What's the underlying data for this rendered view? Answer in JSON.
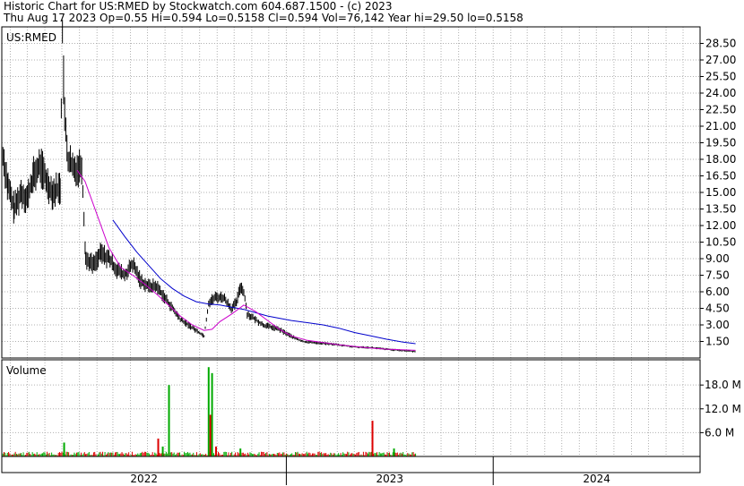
{
  "header": {
    "line1": "Historic Chart for US:RMED by Stockwatch.com 604.687.1500 - (c) 2023",
    "line2": "Thu Aug 17 2023  Op=0.55  Hi=0.594  Lo=0.5158  Cl=0.594  Vol=76,142  Year hi=29.50  lo=0.5158"
  },
  "colors": {
    "price_bars": "#000000",
    "ma_short": "#cc00cc",
    "ma_long": "#0000cc",
    "volume_up": "#00aa00",
    "volume_down": "#dd0000",
    "grid": "#b0b0b0"
  },
  "chart_data": [
    {
      "type": "line",
      "title": "US:RMED",
      "y_ticks": [
        "1.50",
        "3.00",
        "4.50",
        "6.00",
        "7.50",
        "9.00",
        "10.50",
        "12.00",
        "13.50",
        "15.00",
        "16.50",
        "18.00",
        "19.50",
        "21.00",
        "22.50",
        "24.00",
        "25.50",
        "27.00",
        "28.50"
      ],
      "y_tick_values": [
        1.5,
        3,
        4.5,
        6,
        7.5,
        9,
        10.5,
        12,
        13.5,
        15,
        16.5,
        18,
        19.5,
        21,
        22.5,
        24,
        25.5,
        27,
        28.5
      ],
      "ylim": [
        0,
        30
      ],
      "x_range": [
        "2021-08-17",
        "2024-12-31"
      ],
      "x_labels": [
        "2022",
        "2023",
        "2024"
      ],
      "grid": true,
      "price_points": [
        [
          "2021-08-17",
          19.0
        ],
        [
          "2021-08-28",
          15.5
        ],
        [
          "2021-09-08",
          13.5
        ],
        [
          "2021-09-20",
          15.0
        ],
        [
          "2021-10-01",
          14.5
        ],
        [
          "2021-10-12",
          16.5
        ],
        [
          "2021-10-24",
          17.5
        ],
        [
          "2021-11-04",
          16.0
        ],
        [
          "2021-11-15",
          15.0
        ],
        [
          "2021-11-28",
          15.5
        ],
        [
          "2021-12-02",
          29.5
        ],
        [
          "2021-12-06",
          21.5
        ],
        [
          "2021-12-12",
          18.0
        ],
        [
          "2021-12-22",
          17.0
        ],
        [
          "2022-01-05",
          17.5
        ],
        [
          "2022-01-12",
          9.0
        ],
        [
          "2022-01-26",
          8.5
        ],
        [
          "2022-02-08",
          9.5
        ],
        [
          "2022-02-22",
          9.0
        ],
        [
          "2022-03-08",
          8.0
        ],
        [
          "2022-03-22",
          7.5
        ],
        [
          "2022-04-05",
          8.5
        ],
        [
          "2022-04-19",
          7.0
        ],
        [
          "2022-05-03",
          6.5
        ],
        [
          "2022-05-17",
          6.5
        ],
        [
          "2022-05-31",
          5.5
        ],
        [
          "2022-06-14",
          4.5
        ],
        [
          "2022-06-28",
          3.5
        ],
        [
          "2022-07-12",
          3.0
        ],
        [
          "2022-07-26",
          2.5
        ],
        [
          "2022-08-09",
          2.0
        ],
        [
          "2022-08-17",
          5.0
        ],
        [
          "2022-08-29",
          5.5
        ],
        [
          "2022-09-12",
          5.5
        ],
        [
          "2022-09-26",
          4.5
        ],
        [
          "2022-10-05",
          5.0
        ],
        [
          "2022-10-12",
          6.5
        ],
        [
          "2022-10-18",
          6.0
        ],
        [
          "2022-10-24",
          4.0
        ],
        [
          "2022-11-07",
          3.5
        ],
        [
          "2022-11-21",
          3.0
        ],
        [
          "2022-12-05",
          2.8
        ],
        [
          "2022-12-19",
          2.6
        ],
        [
          "2023-01-02",
          2.2
        ],
        [
          "2023-01-16",
          1.8
        ],
        [
          "2023-01-30",
          1.5
        ],
        [
          "2023-02-20",
          1.4
        ],
        [
          "2023-03-13",
          1.3
        ],
        [
          "2023-04-03",
          1.2
        ],
        [
          "2023-05-01",
          1.0
        ],
        [
          "2023-05-29",
          0.95
        ],
        [
          "2023-06-26",
          0.8
        ],
        [
          "2023-07-17",
          0.7
        ],
        [
          "2023-08-17",
          0.594
        ]
      ],
      "ma_short": [
        [
          "2021-12-28",
          17.0
        ],
        [
          "2022-01-11",
          16.0
        ],
        [
          "2022-02-01",
          13.0
        ],
        [
          "2022-02-22",
          10.0
        ],
        [
          "2022-03-15",
          8.2
        ],
        [
          "2022-04-05",
          7.5
        ],
        [
          "2022-04-26",
          6.7
        ],
        [
          "2022-05-17",
          5.8
        ],
        [
          "2022-06-07",
          4.8
        ],
        [
          "2022-06-28",
          3.8
        ],
        [
          "2022-07-19",
          3.0
        ],
        [
          "2022-08-09",
          2.5
        ],
        [
          "2022-08-23",
          2.6
        ],
        [
          "2022-09-06",
          3.3
        ],
        [
          "2022-09-27",
          4.0
        ],
        [
          "2022-10-18",
          4.8
        ],
        [
          "2022-11-08",
          4.2
        ],
        [
          "2022-11-29",
          3.4
        ],
        [
          "2022-12-20",
          2.6
        ],
        [
          "2023-01-10",
          2.0
        ],
        [
          "2023-02-07",
          1.6
        ],
        [
          "2023-03-07",
          1.4
        ],
        [
          "2023-04-04",
          1.2
        ],
        [
          "2023-05-02",
          1.05
        ],
        [
          "2023-05-30",
          0.9
        ],
        [
          "2023-06-27",
          0.8
        ],
        [
          "2023-08-17",
          0.7
        ]
      ],
      "ma_long": [
        [
          "2022-03-01",
          12.5
        ],
        [
          "2022-03-22",
          11.0
        ],
        [
          "2022-04-12",
          9.6
        ],
        [
          "2022-05-03",
          8.4
        ],
        [
          "2022-05-24",
          7.2
        ],
        [
          "2022-06-14",
          6.3
        ],
        [
          "2022-07-05",
          5.6
        ],
        [
          "2022-07-26",
          5.1
        ],
        [
          "2022-08-16",
          4.9
        ],
        [
          "2022-09-06",
          4.8
        ],
        [
          "2022-09-27",
          4.6
        ],
        [
          "2022-10-18",
          4.4
        ],
        [
          "2022-11-08",
          4.1
        ],
        [
          "2022-11-29",
          3.8
        ],
        [
          "2022-12-20",
          3.6
        ],
        [
          "2023-01-10",
          3.4
        ],
        [
          "2023-02-07",
          3.2
        ],
        [
          "2023-03-07",
          3.0
        ],
        [
          "2023-04-04",
          2.7
        ],
        [
          "2023-05-02",
          2.3
        ],
        [
          "2023-05-30",
          2.0
        ],
        [
          "2023-06-27",
          1.7
        ],
        [
          "2023-07-25",
          1.45
        ],
        [
          "2023-08-17",
          1.3
        ]
      ]
    },
    {
      "type": "bar",
      "title": "Volume",
      "y_ticks": [
        "6.0 M",
        "12.0 M",
        "18.0 M"
      ],
      "y_tick_values": [
        6,
        12,
        18
      ],
      "ylim": [
        0,
        23
      ],
      "units": "M",
      "spikes": [
        {
          "date": "2021-12-05",
          "value": 3.5,
          "dir": "up"
        },
        {
          "date": "2022-05-20",
          "value": 4.5,
          "dir": "down"
        },
        {
          "date": "2022-05-28",
          "value": 2.5,
          "dir": "up"
        },
        {
          "date": "2022-06-08",
          "value": 18.0,
          "dir": "up"
        },
        {
          "date": "2022-08-17",
          "value": 22.5,
          "dir": "up"
        },
        {
          "date": "2022-08-20",
          "value": 10.5,
          "dir": "down"
        },
        {
          "date": "2022-08-23",
          "value": 21.0,
          "dir": "up"
        },
        {
          "date": "2022-08-30",
          "value": 2.5,
          "dir": "down"
        },
        {
          "date": "2022-10-12",
          "value": 2.0,
          "dir": "up"
        },
        {
          "date": "2023-06-02",
          "value": 9.0,
          "dir": "down"
        },
        {
          "date": "2023-07-10",
          "value": 2.0,
          "dir": "up"
        }
      ]
    }
  ]
}
